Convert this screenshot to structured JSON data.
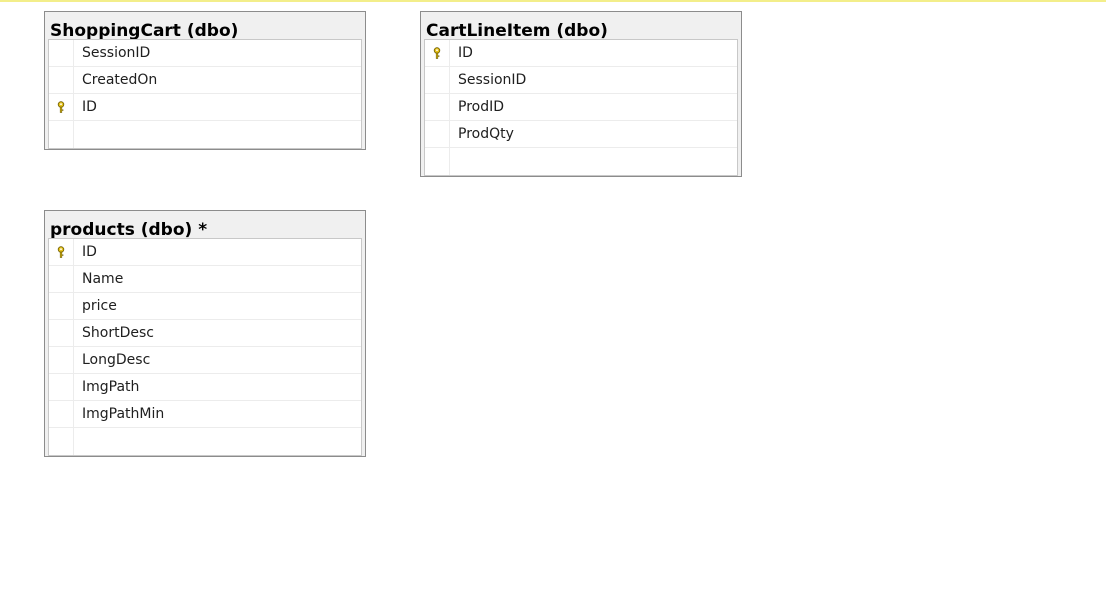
{
  "tables": {
    "shopping_cart": {
      "title": "ShoppingCart (dbo)",
      "columns": [
        {
          "name": "SessionID",
          "primary_key": false
        },
        {
          "name": "CreatedOn",
          "primary_key": false
        },
        {
          "name": "ID",
          "primary_key": true
        }
      ]
    },
    "cart_line_item": {
      "title": "CartLineItem (dbo)",
      "columns": [
        {
          "name": "ID",
          "primary_key": true
        },
        {
          "name": "SessionID",
          "primary_key": false
        },
        {
          "name": "ProdID",
          "primary_key": false
        },
        {
          "name": "ProdQty",
          "primary_key": false
        }
      ]
    },
    "products": {
      "title": "products (dbo) *",
      "columns": [
        {
          "name": "ID",
          "primary_key": true
        },
        {
          "name": "Name",
          "primary_key": false
        },
        {
          "name": "price",
          "primary_key": false
        },
        {
          "name": "ShortDesc",
          "primary_key": false
        },
        {
          "name": "LongDesc",
          "primary_key": false
        },
        {
          "name": "ImgPath",
          "primary_key": false
        },
        {
          "name": "ImgPathMin",
          "primary_key": false
        }
      ]
    }
  },
  "colors": {
    "canvas": "#ffffff",
    "top_strip": "#f3ee8a",
    "table_frame": "#f0f0f0",
    "key_icon": "#e6c21a"
  }
}
